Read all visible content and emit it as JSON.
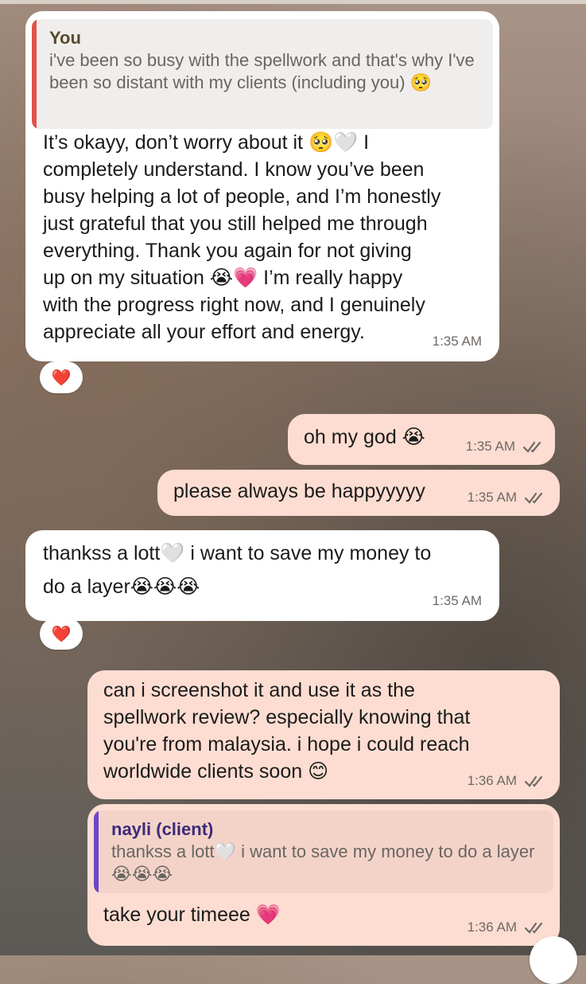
{
  "messages": [
    {
      "quote": {
        "author": "You",
        "text": "i've been so busy with the spellwork and that's why I've been so distant with my clients (including you) 🥺"
      },
      "lines": [
        "It’s okayy, don’t worry about it 🥺🤍 I",
        "completely understand. I know you’ve been",
        "busy helping a lot of people, and I’m honestly",
        "just grateful that you still helped me through",
        "everything. Thank you again for not giving",
        "up on my situation 😭💗 I’m really happy",
        "with the progress right now, and I genuinely",
        "appreciate all your effort and energy."
      ],
      "time": "1:35 AM",
      "reaction": "❤️"
    },
    {
      "text": "oh my god 😭",
      "time": "1:35 AM"
    },
    {
      "text": "please always be happyyyyy",
      "time": "1:35 AM"
    },
    {
      "lines": [
        "thankss a lott🤍 i want to save my money to",
        "do a layer😭😭😭"
      ],
      "time": "1:35 AM",
      "reaction": "❤️"
    },
    {
      "lines": [
        "can i screenshot it and use it as the",
        "spellwork review? especially knowing that",
        "you're from malaysia. i hope i could reach",
        "worldwide clients soon 😊"
      ],
      "time": "1:36 AM"
    },
    {
      "quote": {
        "author": "nayli (client)",
        "text": "thankss a lott🤍 i want to save my money to do a layer😭😭😭"
      },
      "text": "take your timeee 💗",
      "time": "1:36 AM"
    }
  ],
  "colors": {
    "incoming_bubble": "#ffffff",
    "outgoing_bubble": "#fdddd1",
    "quote_bar_incoming": "#e0534a",
    "quote_bar_outgoing": "#6a48c8"
  },
  "icons": {
    "read_receipt": "double-check-icon",
    "reaction": "red-heart-icon",
    "scroll": "scroll-down-button"
  }
}
